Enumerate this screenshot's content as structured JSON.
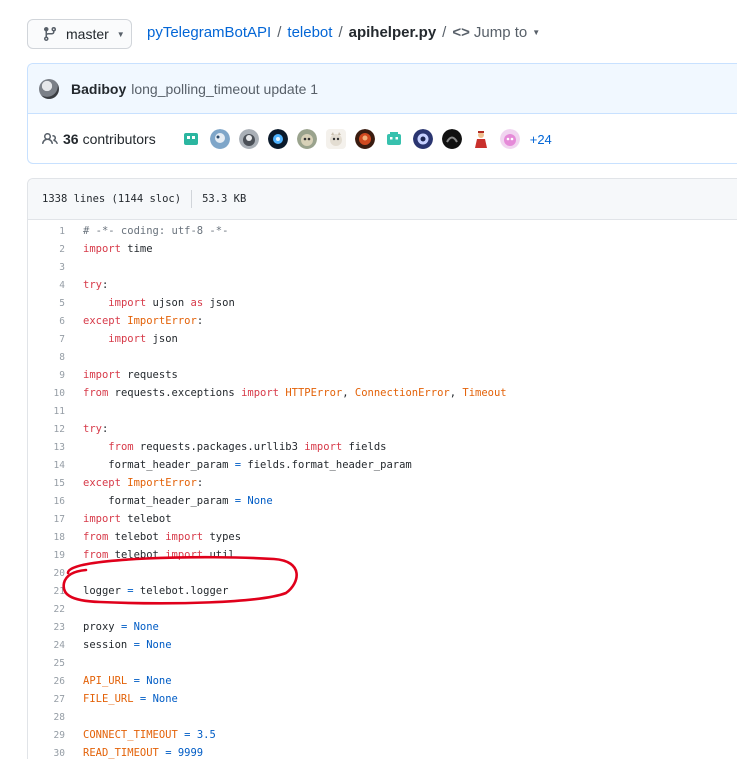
{
  "branch": {
    "label": "master"
  },
  "breadcrumb": {
    "repo": "pyTelegramBotAPI",
    "sep1": "/",
    "folder": "telebot",
    "sep2": "/",
    "file": "apihelper.py",
    "sep3": "/",
    "jump_label": "Jump to"
  },
  "commit": {
    "author": "Badiboy",
    "message": "long_polling_timeout update 1"
  },
  "contributors": {
    "count": "36",
    "label": "contributors",
    "more": "+24",
    "avatars": [
      "teal-robot",
      "blue-bird",
      "gray-cat",
      "blue-glow",
      "helmet-cat",
      "white-cat",
      "red-face",
      "teal-robot-2",
      "blue-eye",
      "dark-bird",
      "red-figure",
      "pink-creature"
    ]
  },
  "file_info": {
    "lines": "1338 lines (1144 sloc)",
    "size": "53.3 KB"
  },
  "code_lines": [
    {
      "n": "1",
      "tokens": [
        {
          "t": "# -*- coding: utf-8 -*-",
          "c": "cm"
        }
      ]
    },
    {
      "n": "2",
      "tokens": [
        {
          "t": "import",
          "c": "kw"
        },
        {
          "t": " time",
          "c": ""
        }
      ]
    },
    {
      "n": "3",
      "tokens": []
    },
    {
      "n": "4",
      "tokens": [
        {
          "t": "try",
          "c": "kw"
        },
        {
          "t": ":",
          "c": ""
        }
      ]
    },
    {
      "n": "5",
      "tokens": [
        {
          "t": "    ",
          "c": ""
        },
        {
          "t": "import",
          "c": "kw"
        },
        {
          "t": " ujson ",
          "c": ""
        },
        {
          "t": "as",
          "c": "kw"
        },
        {
          "t": " json",
          "c": ""
        }
      ]
    },
    {
      "n": "6",
      "tokens": [
        {
          "t": "except",
          "c": "kw"
        },
        {
          "t": " ",
          "c": ""
        },
        {
          "t": "ImportError",
          "c": "cls"
        },
        {
          "t": ":",
          "c": ""
        }
      ]
    },
    {
      "n": "7",
      "tokens": [
        {
          "t": "    ",
          "c": ""
        },
        {
          "t": "import",
          "c": "kw"
        },
        {
          "t": " json",
          "c": ""
        }
      ]
    },
    {
      "n": "8",
      "tokens": []
    },
    {
      "n": "9",
      "tokens": [
        {
          "t": "import",
          "c": "kw"
        },
        {
          "t": " requests",
          "c": ""
        }
      ]
    },
    {
      "n": "10",
      "tokens": [
        {
          "t": "from",
          "c": "kw"
        },
        {
          "t": " requests.exceptions ",
          "c": ""
        },
        {
          "t": "import",
          "c": "kw"
        },
        {
          "t": " ",
          "c": ""
        },
        {
          "t": "HTTPError",
          "c": "cls"
        },
        {
          "t": ", ",
          "c": ""
        },
        {
          "t": "ConnectionError",
          "c": "cls"
        },
        {
          "t": ", ",
          "c": ""
        },
        {
          "t": "Timeout",
          "c": "cls"
        }
      ]
    },
    {
      "n": "11",
      "tokens": []
    },
    {
      "n": "12",
      "tokens": [
        {
          "t": "try",
          "c": "kw"
        },
        {
          "t": ":",
          "c": ""
        }
      ]
    },
    {
      "n": "13",
      "tokens": [
        {
          "t": "    ",
          "c": ""
        },
        {
          "t": "from",
          "c": "kw"
        },
        {
          "t": " requests.packages.urllib3 ",
          "c": ""
        },
        {
          "t": "import",
          "c": "kw"
        },
        {
          "t": " fields",
          "c": ""
        }
      ]
    },
    {
      "n": "14",
      "tokens": [
        {
          "t": "    format_header_param ",
          "c": ""
        },
        {
          "t": "=",
          "c": "const"
        },
        {
          "t": " fields.format_header_param",
          "c": ""
        }
      ]
    },
    {
      "n": "15",
      "tokens": [
        {
          "t": "except",
          "c": "kw"
        },
        {
          "t": " ",
          "c": ""
        },
        {
          "t": "ImportError",
          "c": "cls"
        },
        {
          "t": ":",
          "c": ""
        }
      ]
    },
    {
      "n": "16",
      "tokens": [
        {
          "t": "    format_header_param ",
          "c": ""
        },
        {
          "t": "=",
          "c": "const"
        },
        {
          "t": " ",
          "c": ""
        },
        {
          "t": "None",
          "c": "const"
        }
      ]
    },
    {
      "n": "17",
      "tokens": [
        {
          "t": "import",
          "c": "kw"
        },
        {
          "t": " telebot",
          "c": ""
        }
      ]
    },
    {
      "n": "18",
      "tokens": [
        {
          "t": "from",
          "c": "kw"
        },
        {
          "t": " telebot ",
          "c": ""
        },
        {
          "t": "import",
          "c": "kw"
        },
        {
          "t": " types",
          "c": ""
        }
      ]
    },
    {
      "n": "19",
      "tokens": [
        {
          "t": "from",
          "c": "kw"
        },
        {
          "t": " telebot ",
          "c": ""
        },
        {
          "t": "import",
          "c": "kw"
        },
        {
          "t": " util",
          "c": ""
        }
      ]
    },
    {
      "n": "20",
      "tokens": []
    },
    {
      "n": "21",
      "tokens": [
        {
          "t": "logger ",
          "c": ""
        },
        {
          "t": "=",
          "c": "const"
        },
        {
          "t": " telebot.logger",
          "c": ""
        }
      ]
    },
    {
      "n": "22",
      "tokens": []
    },
    {
      "n": "23",
      "tokens": [
        {
          "t": "proxy ",
          "c": ""
        },
        {
          "t": "=",
          "c": "const"
        },
        {
          "t": " ",
          "c": ""
        },
        {
          "t": "None",
          "c": "const"
        }
      ]
    },
    {
      "n": "24",
      "tokens": [
        {
          "t": "session ",
          "c": ""
        },
        {
          "t": "=",
          "c": "const"
        },
        {
          "t": " ",
          "c": ""
        },
        {
          "t": "None",
          "c": "const"
        }
      ]
    },
    {
      "n": "25",
      "tokens": []
    },
    {
      "n": "26",
      "tokens": [
        {
          "t": "API_URL",
          "c": "cls"
        },
        {
          "t": " ",
          "c": ""
        },
        {
          "t": "=",
          "c": "const"
        },
        {
          "t": " ",
          "c": ""
        },
        {
          "t": "None",
          "c": "const"
        }
      ]
    },
    {
      "n": "27",
      "tokens": [
        {
          "t": "FILE_URL",
          "c": "cls"
        },
        {
          "t": " ",
          "c": ""
        },
        {
          "t": "=",
          "c": "const"
        },
        {
          "t": " ",
          "c": ""
        },
        {
          "t": "None",
          "c": "const"
        }
      ]
    },
    {
      "n": "28",
      "tokens": []
    },
    {
      "n": "29",
      "tokens": [
        {
          "t": "CONNECT_TIMEOUT",
          "c": "cls"
        },
        {
          "t": " ",
          "c": ""
        },
        {
          "t": "=",
          "c": "const"
        },
        {
          "t": " ",
          "c": ""
        },
        {
          "t": "3.5",
          "c": "const"
        }
      ]
    },
    {
      "n": "30",
      "tokens": [
        {
          "t": "READ_TIMEOUT",
          "c": "cls"
        },
        {
          "t": " ",
          "c": ""
        },
        {
          "t": "=",
          "c": "const"
        },
        {
          "t": " ",
          "c": ""
        },
        {
          "t": "9999",
          "c": "const"
        }
      ]
    }
  ],
  "colors": {
    "link": "#0366d6",
    "keyword": "#d73a49",
    "class": "#e36209",
    "constant": "#005cc5",
    "annotation": "#e0001b"
  }
}
